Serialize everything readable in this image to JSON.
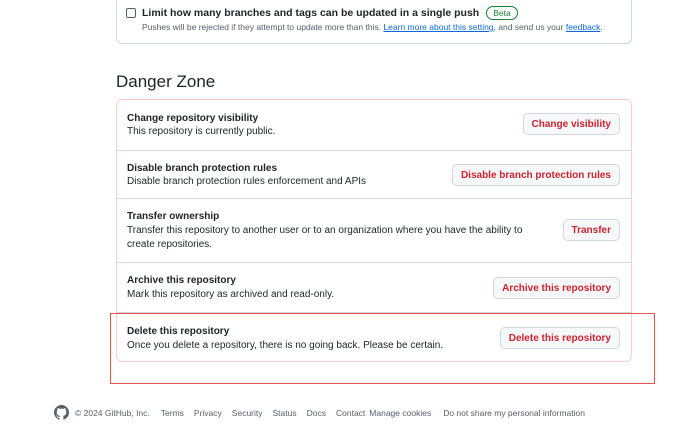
{
  "push_limit": {
    "label": "Limit how many branches and tags can be updated in a single push",
    "badge": "Beta",
    "desc_prefix": "Pushes will be rejected if they attempt to update more than this. ",
    "learn_more": "Learn more about this setting",
    "desc_middle": ", and send us your ",
    "feedback": "feedback",
    "desc_suffix": ".",
    "checked": false
  },
  "danger_zone": {
    "heading": "Danger Zone",
    "rows": [
      {
        "title": "Change repository visibility",
        "desc": "This repository is currently public.",
        "button": "Change visibility"
      },
      {
        "title": "Disable branch protection rules",
        "desc": "Disable branch protection rules enforcement and APIs",
        "button": "Disable branch protection rules"
      },
      {
        "title": "Transfer ownership",
        "desc": "Transfer this repository to another user or to an organization where you have the ability to create repositories.",
        "button": "Transfer"
      },
      {
        "title": "Archive this repository",
        "desc": "Mark this repository as archived and read-only.",
        "button": "Archive this repository"
      },
      {
        "title": "Delete this repository",
        "desc": "Once you delete a repository, there is no going back. Please be certain.",
        "button": "Delete this repository"
      }
    ]
  },
  "footer": {
    "copyright": "© 2024 GitHub, Inc.",
    "links": [
      "Terms",
      "Privacy",
      "Security",
      "Status",
      "Docs",
      "Contact",
      "Manage cookies",
      "Do not share my personal information"
    ]
  },
  "colors": {
    "danger": "#cf222e",
    "danger_border": "#ffcecb",
    "link": "#0969da",
    "success": "#1a7f37",
    "highlight": "#e5534b"
  }
}
